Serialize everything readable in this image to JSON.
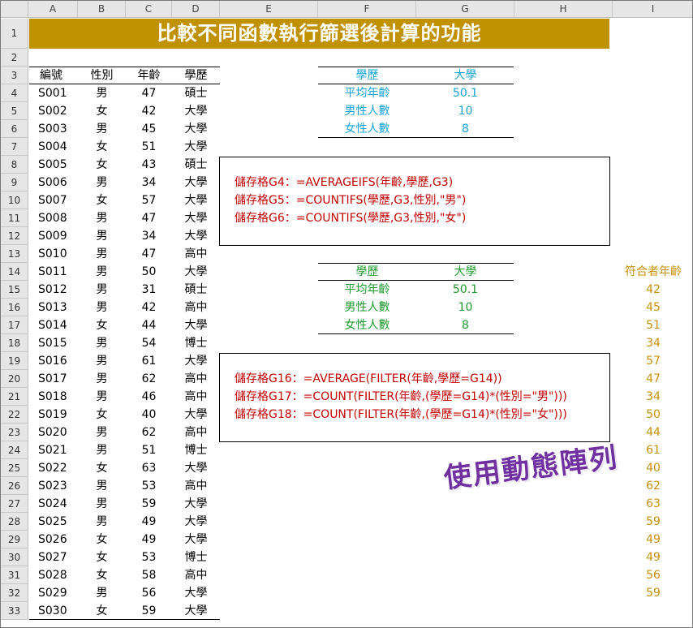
{
  "columns": [
    "A",
    "B",
    "C",
    "D",
    "E",
    "F",
    "G",
    "H",
    "I"
  ],
  "rows": [
    "1",
    "2",
    "3",
    "4",
    "5",
    "6",
    "7",
    "8",
    "9",
    "10",
    "11",
    "12",
    "13",
    "14",
    "15",
    "16",
    "17",
    "18",
    "19",
    "20",
    "21",
    "22",
    "23",
    "24",
    "25",
    "26",
    "27",
    "28",
    "29",
    "30",
    "31",
    "32",
    "33"
  ],
  "title": "比較不同函數執行篩選後計算的功能",
  "table": {
    "headers": [
      "編號",
      "性別",
      "年齡",
      "學歷"
    ],
    "rows": [
      [
        "S001",
        "男",
        "47",
        "碩士"
      ],
      [
        "S002",
        "女",
        "42",
        "大學"
      ],
      [
        "S003",
        "男",
        "45",
        "大學"
      ],
      [
        "S004",
        "女",
        "51",
        "大學"
      ],
      [
        "S005",
        "女",
        "43",
        "碩士"
      ],
      [
        "S006",
        "男",
        "34",
        "大學"
      ],
      [
        "S007",
        "女",
        "57",
        "大學"
      ],
      [
        "S008",
        "男",
        "47",
        "大學"
      ],
      [
        "S009",
        "男",
        "34",
        "大學"
      ],
      [
        "S010",
        "男",
        "47",
        "高中"
      ],
      [
        "S011",
        "男",
        "50",
        "大學"
      ],
      [
        "S012",
        "男",
        "31",
        "碩士"
      ],
      [
        "S013",
        "男",
        "42",
        "高中"
      ],
      [
        "S014",
        "女",
        "44",
        "大學"
      ],
      [
        "S015",
        "男",
        "54",
        "博士"
      ],
      [
        "S016",
        "男",
        "61",
        "大學"
      ],
      [
        "S017",
        "男",
        "62",
        "高中"
      ],
      [
        "S018",
        "男",
        "46",
        "高中"
      ],
      [
        "S019",
        "女",
        "40",
        "大學"
      ],
      [
        "S020",
        "男",
        "62",
        "高中"
      ],
      [
        "S021",
        "男",
        "51",
        "博士"
      ],
      [
        "S022",
        "女",
        "63",
        "大學"
      ],
      [
        "S023",
        "男",
        "53",
        "高中"
      ],
      [
        "S024",
        "男",
        "59",
        "大學"
      ],
      [
        "S025",
        "男",
        "49",
        "大學"
      ],
      [
        "S026",
        "女",
        "49",
        "大學"
      ],
      [
        "S027",
        "女",
        "53",
        "博士"
      ],
      [
        "S028",
        "女",
        "58",
        "高中"
      ],
      [
        "S029",
        "男",
        "56",
        "大學"
      ],
      [
        "S030",
        "女",
        "59",
        "大學"
      ]
    ]
  },
  "summary1": {
    "header": [
      "學歷",
      "大學"
    ],
    "rows": [
      [
        "平均年齡",
        "50.1"
      ],
      [
        "男性人數",
        "10"
      ],
      [
        "女性人數",
        "8"
      ]
    ]
  },
  "formulas1": [
    "儲存格G4：=AVERAGEIFS(年齡,學歷,G3)",
    "儲存格G5：=COUNTIFS(學歷,G3,性別,\"男\")",
    "儲存格G6：=COUNTIFS(學歷,G3,性別,\"女\")"
  ],
  "summary2": {
    "header": [
      "學歷",
      "大學"
    ],
    "rows": [
      [
        "平均年齡",
        "50.1"
      ],
      [
        "男性人數",
        "10"
      ],
      [
        "女性人數",
        "8"
      ]
    ]
  },
  "formulas2": [
    "儲存格G16：=AVERAGE(FILTER(年齡,學歷=G14))",
    "儲存格G17：=COUNT(FILTER(年齡,(學歷=G14)*(性別=\"男\")))",
    "儲存格G18：=COUNT(FILTER(年齡,(學歷=G14)*(性別=\"女\")))"
  ],
  "matching_ages": {
    "header": "符合者年齡",
    "values": [
      "42",
      "45",
      "51",
      "34",
      "57",
      "47",
      "34",
      "50",
      "44",
      "61",
      "40",
      "62",
      "63",
      "59",
      "49",
      "49",
      "56",
      "59"
    ]
  },
  "stamp": "使用動態陣列",
  "colors": {
    "title_bg": "#c09100",
    "summary1": "#18a3d6",
    "summary2": "#1f9a2f",
    "formula": "#c00000",
    "ages": "#c8900e",
    "stamp": "#7030a0"
  }
}
